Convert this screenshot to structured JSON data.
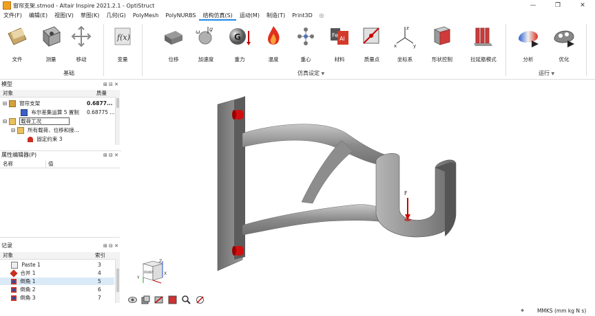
{
  "window": {
    "title": "窗帘支架.stmod - Altair Inspire 2021.2.1 - OptiStruct",
    "minimize_glyph": "—",
    "restore_glyph": "❐",
    "close_glyph": "✕"
  },
  "menu": {
    "items": [
      "文件(F)",
      "编辑(E)",
      "视图(V)",
      "草图(K)",
      "几何(G)",
      "PolyMesh",
      "PolyNURBS",
      "结构仿真(S)",
      "运动(M)",
      "制造(T)",
      "Print3D"
    ],
    "plus": "⊕"
  },
  "ribbon": {
    "basic": {
      "label": "基础",
      "tools": [
        "文件",
        "测量",
        "移动"
      ]
    },
    "variables": {
      "tools": [
        "变量"
      ]
    },
    "sim": {
      "label": "仿真设定",
      "dropdown": "▼",
      "tools": [
        "位移",
        "加速度",
        "重力",
        "温度",
        "重心",
        "材料",
        "质量点",
        "坐标系",
        "形状控制",
        "拉延筋模式"
      ]
    },
    "run": {
      "label": "运行",
      "dropdown": "▼",
      "tools": [
        "分析",
        "优化"
      ]
    }
  },
  "model_panel": {
    "title": "模型",
    "col_object": "对象",
    "col_mass": "质量",
    "rows": [
      {
        "toggle": "⊟",
        "label": "窗帘支架",
        "mass": "0.6877..."
      },
      {
        "toggle": "",
        "label": "布尔差集运算 5 置制",
        "mass": "0.68775 ..."
      },
      {
        "toggle": "⊟",
        "label": "载荷工况",
        "mass": ""
      },
      {
        "toggle": "⊟",
        "label": "所有载荷、位移和接...",
        "mass": ""
      },
      {
        "toggle": "",
        "label": "固定约束 3",
        "mass": ""
      }
    ]
  },
  "property_panel": {
    "title": "属性编辑器(P)",
    "col_name": "名称",
    "col_value": "值"
  },
  "history_panel": {
    "title": "记录",
    "col_object": "对象",
    "col_index": "索引",
    "rows": [
      {
        "label": "Paste 1",
        "index": "3"
      },
      {
        "label": "合并 1",
        "index": "4"
      },
      {
        "label": "倒角 1",
        "index": "5"
      },
      {
        "label": "倒角 2",
        "index": "6"
      },
      {
        "label": "倒角 3",
        "index": "7"
      }
    ]
  },
  "viewport": {
    "force_label": "F",
    "axis_x": "X",
    "axis_y": "Y",
    "axis_z": "Z",
    "cube_front": "FRONT"
  },
  "status": {
    "units": "MMKS (mm kg N s)"
  },
  "colors": {
    "accent": "#1e88e5",
    "part_gray": "#8e8e8e",
    "bolt_red": "#d01010"
  }
}
